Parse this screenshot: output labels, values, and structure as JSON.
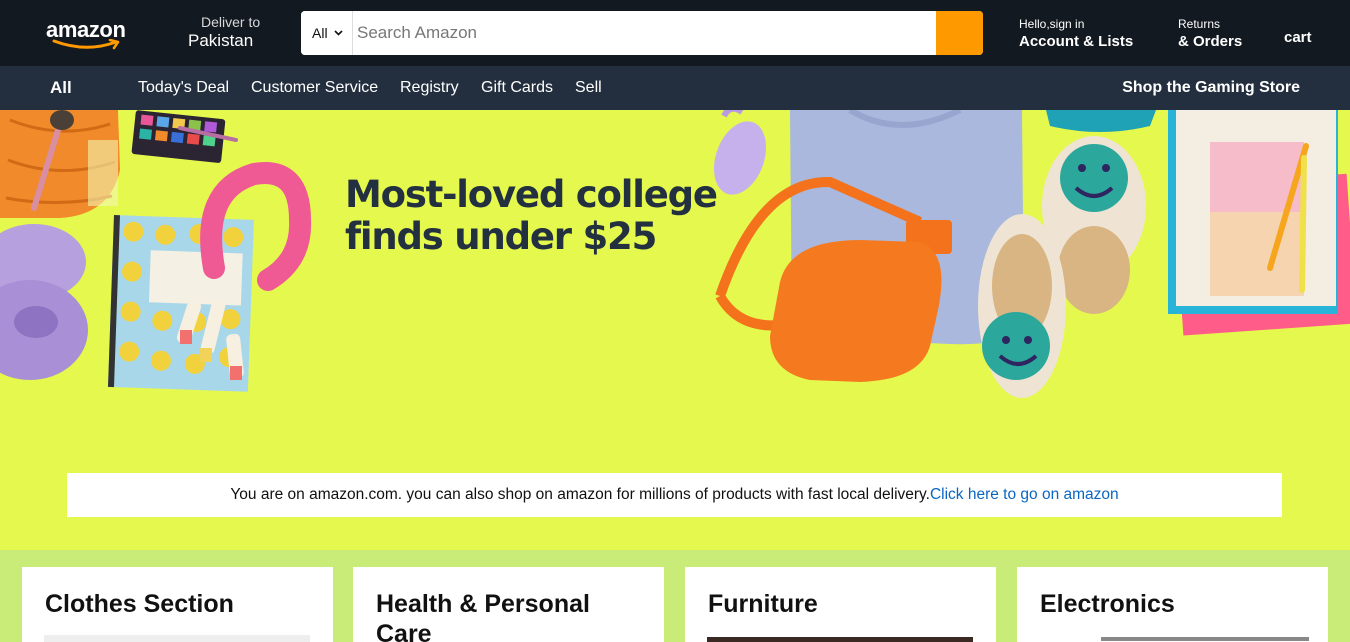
{
  "header": {
    "logo_text": "amazon",
    "deliver_label": "Deliver to",
    "deliver_country": "Pakistan",
    "search": {
      "category": "All",
      "placeholder": "Search Amazon"
    },
    "account_small": "Hello,sign in",
    "account_big": "Account & Lists",
    "returns_small": "Returns",
    "returns_big": "& Orders",
    "cart": "cart"
  },
  "subnav": {
    "all": "All",
    "items": [
      "Today's Deal",
      "Customer Service",
      "Registry",
      "Gift Cards",
      "Sell"
    ],
    "promo": "Shop the Gaming Store"
  },
  "hero": {
    "title": "Most-loved college finds under $25",
    "notice_text": "You are on amazon.com. you can also shop on amazon for millions of products with fast local delivery.",
    "notice_link": "Click here to go on amazon"
  },
  "cards": [
    {
      "title": "Clothes Section"
    },
    {
      "title": "Health & Personal Care"
    },
    {
      "title": "Furniture"
    },
    {
      "title": "Electronics"
    }
  ],
  "colors": {
    "nav_dark": "#131921",
    "subnav": "#232f3e",
    "search_button": "#fe9a00",
    "hero_bg": "#e5f84e",
    "page_bg": "#c9ec79",
    "link": "#0a66c2"
  },
  "icons": [
    "amazon-smile-icon",
    "chevron-down-icon"
  ]
}
